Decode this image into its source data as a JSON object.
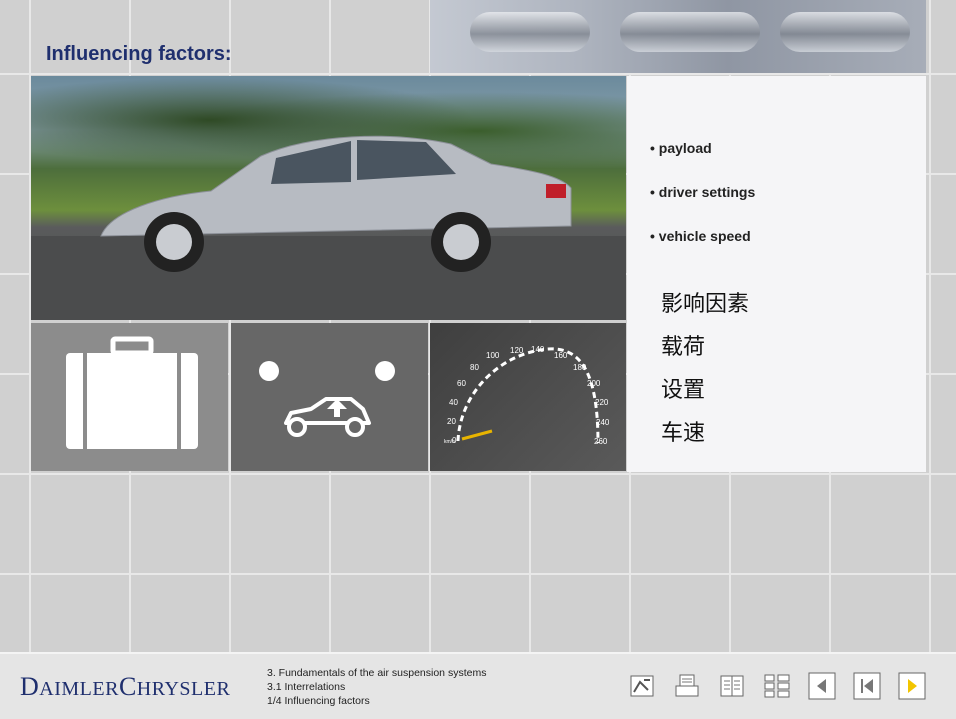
{
  "page": {
    "title": "Influencing factors:"
  },
  "factors_en": [
    "payload",
    "driver settings",
    "vehicle speed"
  ],
  "factors_cn": [
    "影响因素",
    "载荷",
    "设置",
    "车速"
  ],
  "speedometer": {
    "ticks": [
      "0",
      "20",
      "40",
      "60",
      "80",
      "100",
      "120",
      "140",
      "160",
      "180",
      "200",
      "220",
      "240",
      "260"
    ],
    "unit": "km/h"
  },
  "footer": {
    "logo_big_1": "D",
    "logo_small_1": "AIMLER",
    "logo_big_2": "C",
    "logo_small_2": "HRYSLER",
    "breadcrumb": [
      "3. Fundamentals of the air suspension systems",
      "3.1 Interrelations",
      "1/4 Influencing factors"
    ]
  },
  "nav_icons": [
    "glossary-icon",
    "print-icon",
    "index-icon",
    "contents-icon",
    "previous-icon",
    "first-page-icon",
    "next-icon"
  ],
  "colors": {
    "accent": "#1f2f6e",
    "next_arrow": "#f2c500",
    "gauge_needle": "#e8b400"
  }
}
